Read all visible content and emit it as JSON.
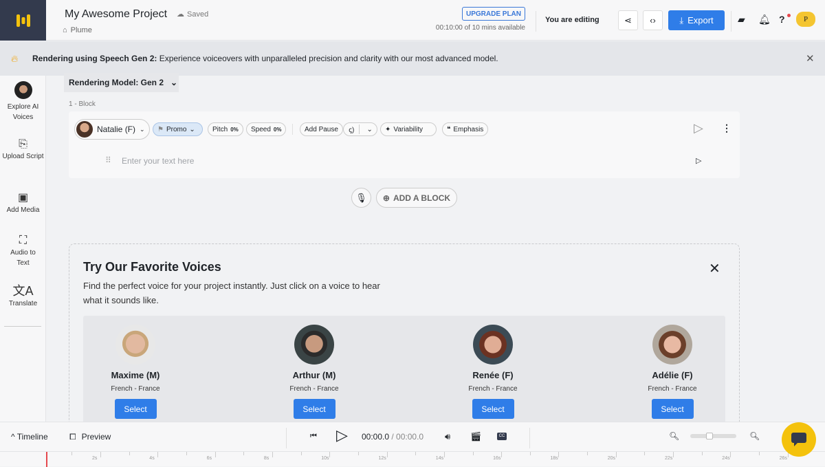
{
  "header": {
    "project_title": "My Awesome Project",
    "saved_label": "Saved",
    "breadcrumb": "Plume",
    "upgrade_label": "UPGRADE PLAN",
    "minutes": "00:10:00 of 10 mins available",
    "editing": "You are editing",
    "export_label": "Export",
    "avatar_letter": "P"
  },
  "banner": {
    "bold": "Rendering using Speech Gen 2:",
    "text": " Experience voiceovers with unparalleled precision and clarity with our most advanced model."
  },
  "sidebar": {
    "items": [
      {
        "label": "Explore AI Voices",
        "icon": "avatar"
      },
      {
        "label": "Upload Script",
        "icon": "upload-doc-icon"
      },
      {
        "label": "Add Media",
        "icon": "media-icon"
      },
      {
        "label": "Audio to Text",
        "icon": "transcribe-icon"
      },
      {
        "label": "Translate",
        "icon": "translate-icon"
      }
    ]
  },
  "editor": {
    "model_label": "Rendering Model: Gen 2",
    "block_label": "1 -  Block",
    "voice": "Natalie (F)",
    "style": "Promo",
    "pitch_label": "Pitch",
    "pitch_value": "0%",
    "speed_label": "Speed",
    "speed_value": "0%",
    "add_pause": "Add Pause",
    "variability": "Variability",
    "emphasis": "Emphasis",
    "text_placeholder": "Enter your text here",
    "add_block": "ADD A BLOCK"
  },
  "favorites": {
    "title": "Try Our Favorite Voices",
    "description": "Find the perfect voice for your project instantly. Just click on a voice to hear what it sounds like.",
    "select_label": "Select",
    "voices": [
      {
        "name": "Maxime (M)",
        "lang": "French - France"
      },
      {
        "name": "Arthur (M)",
        "lang": "French - France"
      },
      {
        "name": "Renée (F)",
        "lang": "French - France"
      },
      {
        "name": "Adélie (F)",
        "lang": "French - France"
      }
    ]
  },
  "player": {
    "timeline_label": "Timeline",
    "preview_label": "Preview",
    "current": "00:00.0",
    "total": " / 00:00.0",
    "zoom_level": 0.4,
    "ticks": [
      "2s",
      "4s",
      "6s",
      "8s",
      "10s",
      "12s",
      "14s",
      "16s",
      "18s",
      "20s",
      "22s",
      "24s",
      "26s"
    ]
  },
  "colors": {
    "accent": "#2f7de8",
    "logo_bg": "#333a4d",
    "brand_yellow": "#f4c20d"
  }
}
